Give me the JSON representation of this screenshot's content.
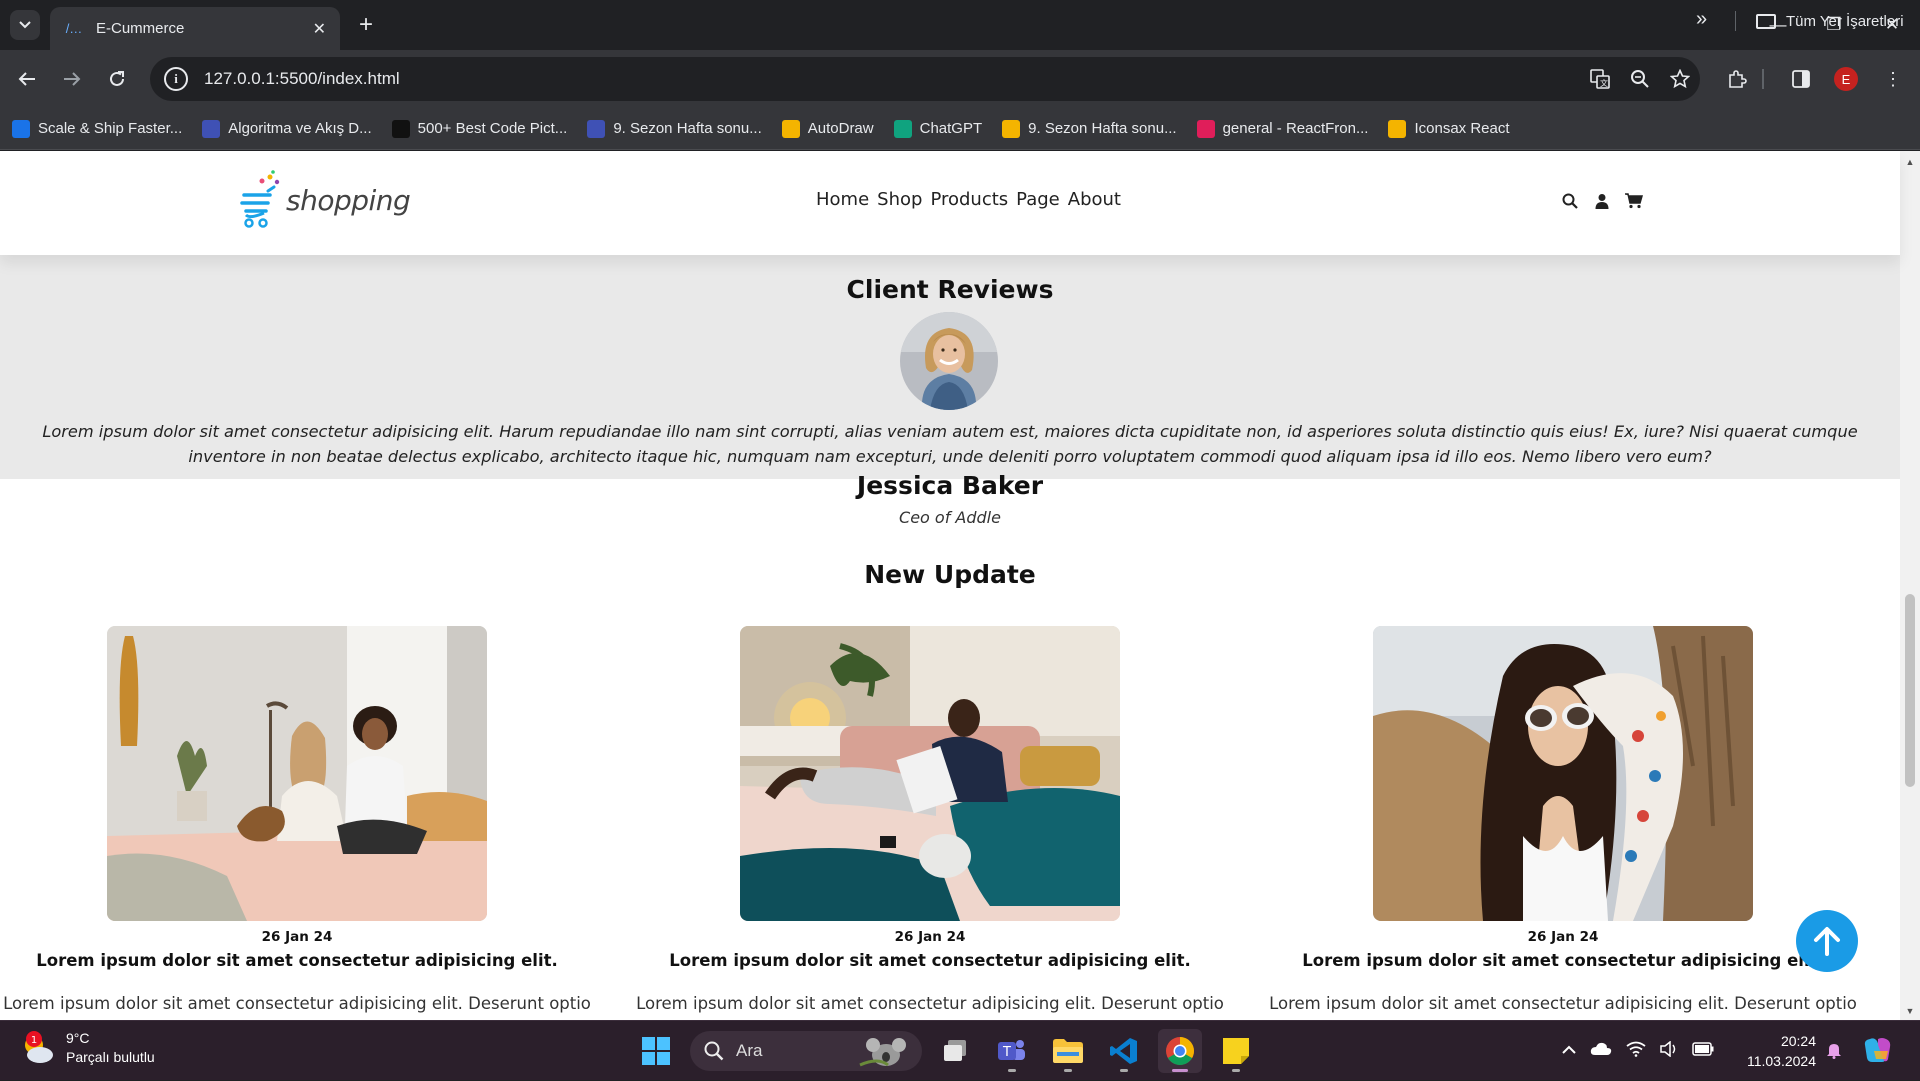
{
  "browser": {
    "tab_title": "E-Cummerce",
    "url": "127.0.0.1:5500/index.html",
    "profile_initial": "E",
    "bookmarks": [
      {
        "label": "Scale & Ship Faster...",
        "color": "#1a73e8"
      },
      {
        "label": "Algoritma ve Akış D...",
        "color": "#3f51b5"
      },
      {
        "label": "500+ Best Code Pict...",
        "color": "#111111"
      },
      {
        "label": "9. Sezon Hafta sonu...",
        "color": "#3f51b5"
      },
      {
        "label": "AutoDraw",
        "color": "#f4b400"
      },
      {
        "label": "ChatGPT",
        "color": "#10a37f"
      },
      {
        "label": "9. Sezon Hafta sonu...",
        "color": "#f4b400"
      },
      {
        "label": "general - ReactFron...",
        "color": "#e01e5a"
      },
      {
        "label": "Iconsax React",
        "color": "#f4b400"
      }
    ],
    "all_bookmarks_label": "Tüm Yer İşaretleri"
  },
  "site": {
    "logo_text": "shopping",
    "nav": [
      "Home",
      "Shop",
      "Products",
      "Page",
      "About"
    ],
    "header_icons": [
      "search-icon",
      "user-icon",
      "cart-icon"
    ]
  },
  "reviews": {
    "heading": "Client Reviews",
    "text": "Lorem ipsum dolor sit amet consectetur adipisicing elit. Harum repudiandae illo nam sint corrupti, alias veniam autem est, maiores dicta cupiditate non, id asperiores soluta distinctio quis eius! Ex, iure? Nisi quaerat cumque inventore in non beatae delectus explicabo, architecto itaque hic, numquam nam excepturi, unde deleniti porro voluptatem commodi quod aliquam ipsa id illo eos. Nemo libero vero eum?",
    "name": "Jessica Baker",
    "role": "Ceo of Addle"
  },
  "updates": {
    "heading": "New Update",
    "posts": [
      {
        "date": "26 Jan 24",
        "title": "Lorem ipsum dolor sit amet consectetur adipisicing elit.",
        "excerpt": "Lorem ipsum dolor sit amet consectetur adipisicing elit. Deserunt optio"
      },
      {
        "date": "26 Jan 24",
        "title": "Lorem ipsum dolor sit amet consectetur adipisicing elit.",
        "excerpt": "Lorem ipsum dolor sit amet consectetur adipisicing elit. Deserunt optio"
      },
      {
        "date": "26 Jan 24",
        "title": "Lorem ipsum dolor sit amet consectetur adipisicing elit.",
        "excerpt": "Lorem ipsum dolor sit amet consectetur adipisicing elit. Deserunt optio"
      }
    ]
  },
  "taskbar": {
    "weather_temp": "9°C",
    "weather_desc": "Parçalı bulutlu",
    "weather_badge": "1",
    "search_label": "Ara",
    "time": "20:24",
    "date": "11.03.2024"
  },
  "colors": {
    "accent": "#1a9be6",
    "review_bg": "#e9e9e9"
  }
}
